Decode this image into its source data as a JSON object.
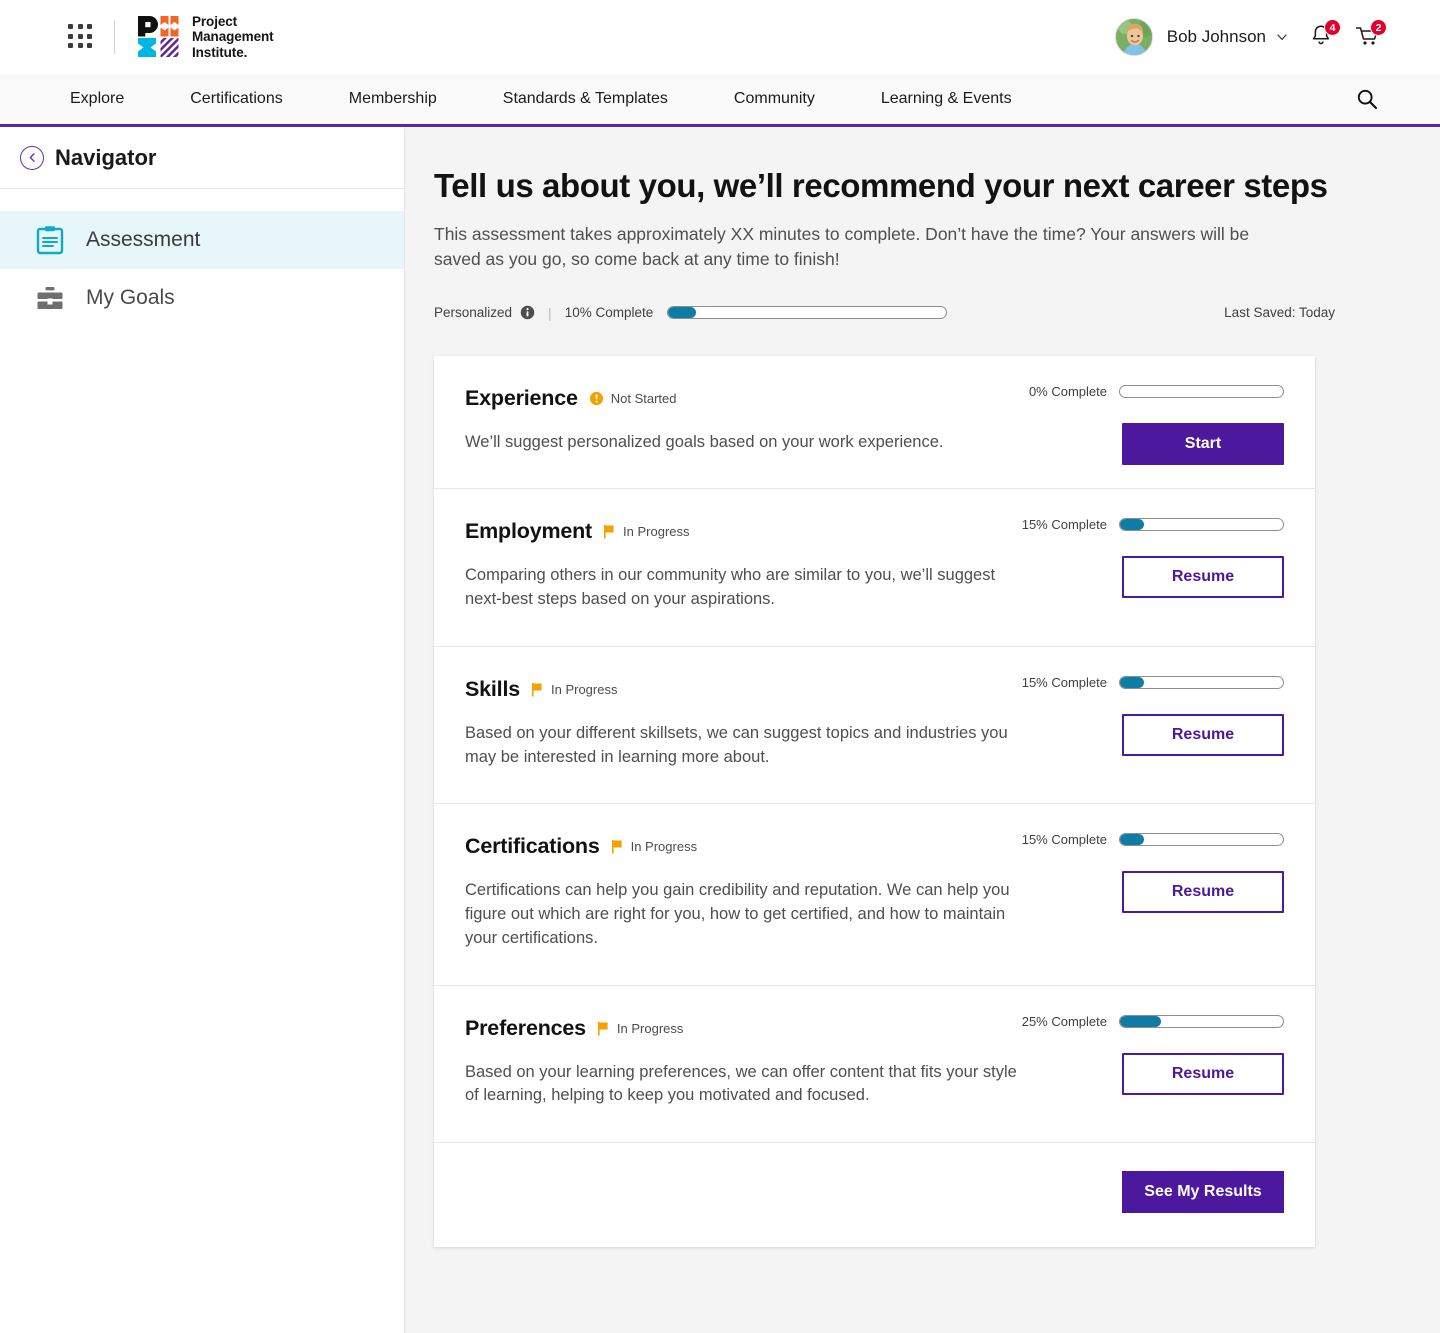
{
  "brand": {
    "logo_line1": "Project",
    "logo_line2": "Management",
    "logo_line3": "Institute.",
    "accent_purple": "#4b189e",
    "accent_teal": "#0e7ca4",
    "accent_orange": "#f5a000",
    "accent_red": "#e4002b"
  },
  "topbar": {
    "waffle_icon": "apps-grid-icon",
    "user_name": "Bob Johnson",
    "chevron_icon": "chevron-down-icon",
    "notifications_icon": "bell-icon",
    "notifications_count": "4",
    "cart_icon": "cart-icon",
    "cart_count": "2"
  },
  "nav": {
    "items": [
      {
        "label": "Explore"
      },
      {
        "label": "Certifications"
      },
      {
        "label": "Membership"
      },
      {
        "label": "Standards & Templates"
      },
      {
        "label": "Community"
      },
      {
        "label": "Learning & Events"
      }
    ],
    "search_icon": "search-icon"
  },
  "sidebar": {
    "back_icon": "chevron-left-circle-icon",
    "title": "Navigator",
    "items": [
      {
        "label": "Assessment",
        "icon": "clipboard-icon",
        "active": true
      },
      {
        "label": "My Goals",
        "icon": "briefcase-icon",
        "active": false
      }
    ]
  },
  "main": {
    "title": "Tell us about you, we’ll recommend your next career steps",
    "lede": "This assessment takes approximately XX minutes to complete. Don’t have the time? Your answers will be saved as you go, so come back at any time to finish!",
    "meta": {
      "personalized_label": "Personalized",
      "info_icon": "info-icon",
      "separator": "|",
      "percent_label": "10% Complete",
      "percent_value": 10,
      "last_saved": "Last Saved: Today"
    },
    "sections": [
      {
        "title": "Experience",
        "status": "Not Started",
        "status_icon": "alert-circle-icon",
        "description": "We’ll suggest personalized goals based on your work experience.",
        "percent_label": "0% Complete",
        "percent_value": 0,
        "button_label": "Start",
        "button_style": "solid"
      },
      {
        "title": "Employment",
        "status": "In Progress",
        "status_icon": "flag-icon",
        "description": "Comparing others in our community who are similar to you, we’ll suggest next-best steps based on your aspirations.",
        "percent_label": "15% Complete",
        "percent_value": 15,
        "button_label": "Resume",
        "button_style": "outline"
      },
      {
        "title": "Skills",
        "status": "In Progress",
        "status_icon": "flag-icon",
        "description": "Based on your different skillsets, we can suggest topics and industries you may be interested in learning more about.",
        "percent_label": "15% Complete",
        "percent_value": 15,
        "button_label": "Resume",
        "button_style": "outline"
      },
      {
        "title": "Certifications",
        "status": "In Progress",
        "status_icon": "flag-icon",
        "description": "Certifications can help you gain credibility and reputation. We can help you figure out which are right for you, how to get certified, and how to maintain your certifications.",
        "percent_label": "15% Complete",
        "percent_value": 15,
        "button_label": "Resume",
        "button_style": "outline"
      },
      {
        "title": "Preferences",
        "status": "In Progress",
        "status_icon": "flag-icon",
        "description": "Based on your learning preferences, we can offer content that fits your style of learning, helping to keep you motivated and focused.",
        "percent_label": "25% Complete",
        "percent_value": 25,
        "button_label": "Resume",
        "button_style": "outline"
      }
    ],
    "results_button_label": "See My Results"
  }
}
